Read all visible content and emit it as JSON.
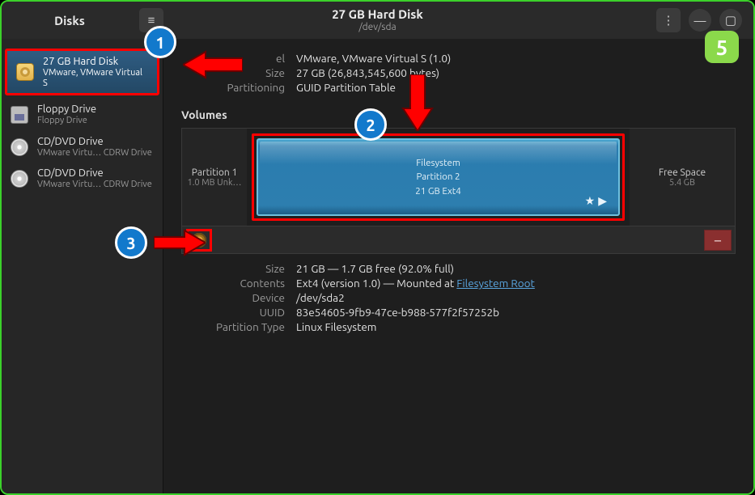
{
  "app_title": "Disks",
  "header": {
    "title": "27 GB Hard Disk",
    "sub": "/dev/sda"
  },
  "sidebar": {
    "devices": [
      {
        "name": "27 GB Hard Disk",
        "sub": "VMware, VMware Virtual S",
        "type": "hd",
        "selected": true
      },
      {
        "name": "Floppy Drive",
        "sub": "Floppy Drive",
        "type": "fd",
        "selected": false
      },
      {
        "name": "CD/DVD Drive",
        "sub": "VMware Virtu… CDRW Drive",
        "type": "cd",
        "selected": false
      },
      {
        "name": "CD/DVD Drive",
        "sub": "VMware Virtu… CDRW Drive",
        "type": "cd",
        "selected": false
      }
    ]
  },
  "disk": {
    "model_label": "el",
    "model": "VMware, VMware Virtual S (1.0)",
    "size_label": "Size",
    "size": "27 GB (26,843,545,600 bytes)",
    "partitioning_label": "Partitioning",
    "partitioning": "GUID Partition Table"
  },
  "volumes_label": "Volumes",
  "volumes": {
    "p1": {
      "title": "Partition 1",
      "sub": "1.0 MB Unk…"
    },
    "p2": {
      "l1": "Filesystem",
      "l2": "Partition 2",
      "l3": "21 GB Ext4"
    },
    "free": {
      "title": "Free Space",
      "sub": "5.4 GB"
    }
  },
  "details": {
    "size_label": "Size",
    "size": "21 GB — 1.7 GB free (92.0% full)",
    "contents_label": "Contents",
    "contents_prefix": "Ext4 (version 1.0) — Mounted at ",
    "contents_link": "Filesystem Root",
    "device_label": "Device",
    "device": "/dev/sda2",
    "uuid_label": "UUID",
    "uuid": "83e54605-9fb9-47ce-b988-577f2f57252b",
    "ptype_label": "Partition Type",
    "ptype": "Linux Filesystem"
  },
  "callouts": {
    "c1": "1",
    "c2": "2",
    "c3": "3",
    "c5": "5"
  },
  "icons": {
    "hamburger": "≡",
    "kebab": "⋮",
    "minimize": "—",
    "maximize": "▢",
    "minus": "−",
    "star": "★",
    "play": "▶"
  }
}
